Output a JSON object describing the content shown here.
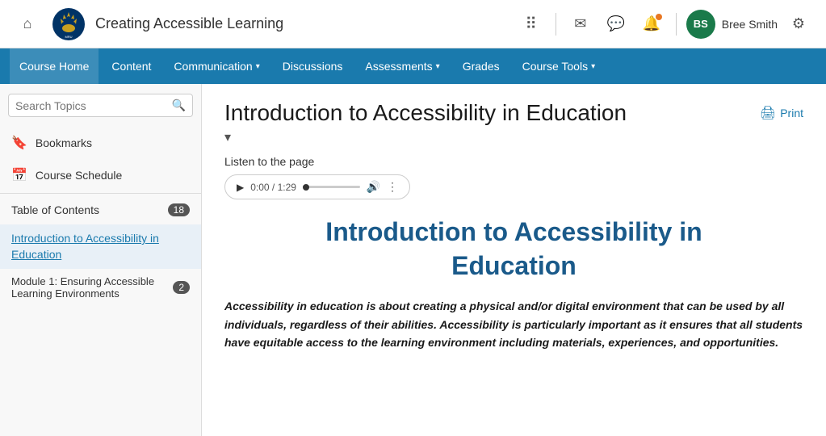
{
  "topbar": {
    "course_title": "Creating Accessible Learning",
    "user_name": "Bree Smith",
    "user_initials": "BS",
    "avatar_color": "#1a7a4a"
  },
  "nav": {
    "items": [
      {
        "label": "Course Home",
        "has_dropdown": false,
        "active": true
      },
      {
        "label": "Content",
        "has_dropdown": false,
        "active": false
      },
      {
        "label": "Communication",
        "has_dropdown": true,
        "active": false
      },
      {
        "label": "Discussions",
        "has_dropdown": false,
        "active": false
      },
      {
        "label": "Assessments",
        "has_dropdown": true,
        "active": false
      },
      {
        "label": "Grades",
        "has_dropdown": false,
        "active": false
      },
      {
        "label": "Course Tools",
        "has_dropdown": true,
        "active": false
      }
    ]
  },
  "sidebar": {
    "search_placeholder": "Search Topics",
    "bookmarks_label": "Bookmarks",
    "schedule_label": "Course Schedule",
    "toc_label": "Table of Contents",
    "toc_count": "18",
    "toc_active_link": "Introduction to Accessibility in Education",
    "module1_label": "Module 1: Ensuring Accessible Learning Environments",
    "module1_count": "2"
  },
  "content": {
    "page_title": "Introduction to Accessibility in Education",
    "print_label": "Print",
    "listen_label": "Listen to the page",
    "audio_time": "0:00 / 1:29",
    "content_h1_line1": "Introduction to Accessibility in",
    "content_h1_line2": "Education",
    "body_text": "Accessibility in education is about creating a physical and/or digital environment that can be used by all individuals, regardless of their abilities. Accessibility is particularly important as it ensures that all students have equitable access to the learning environment including materials, experiences, and opportunities."
  },
  "icons": {
    "home": "⌂",
    "grid": "⠿",
    "mail": "✉",
    "chat": "💬",
    "bell": "🔔",
    "gear": "⚙",
    "search": "🔍",
    "bookmark": "🔖",
    "calendar": "📅",
    "play": "▶",
    "volume": "🔊",
    "more": "⋮",
    "print": "🖨",
    "chevron_down": "▾"
  }
}
